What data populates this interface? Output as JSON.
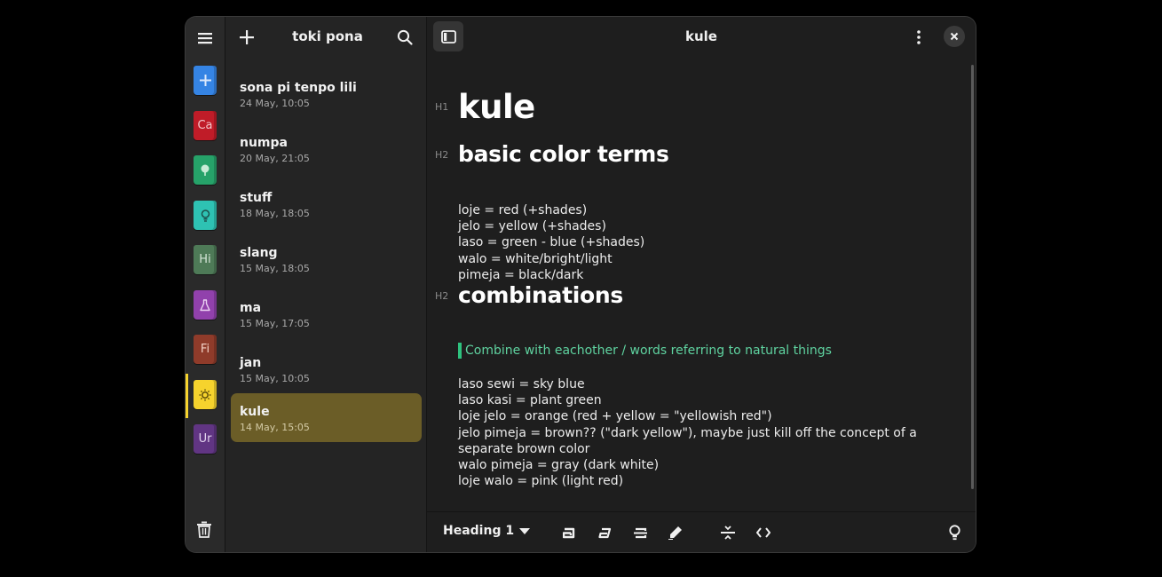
{
  "window": {
    "background": "#1e1e1e",
    "accent": "#f6d32d",
    "selection_color": "#6b5d27"
  },
  "rail": {
    "menu_icon": "hamburger-menu-icon",
    "notebooks": [
      {
        "label": "",
        "icon": "plus-icon",
        "color": "#3584e4"
      },
      {
        "label": "Ca",
        "icon": "",
        "color": "#c01c28"
      },
      {
        "label": "",
        "icon": "tree-icon",
        "color": "#26a269"
      },
      {
        "label": "",
        "icon": "lightbulb-icon",
        "color": "#2ec2b3"
      },
      {
        "label": "Hi",
        "icon": "",
        "color": "#4e7a57"
      },
      {
        "label": "",
        "icon": "flask-icon",
        "color": "#9141ac"
      },
      {
        "label": "Fi",
        "icon": "",
        "color": "#8f3b2a"
      },
      {
        "label": "",
        "icon": "sun-icon",
        "color": "#f6d32d"
      },
      {
        "label": "Ur",
        "icon": "",
        "color": "#613583"
      }
    ],
    "trash_icon": "trash-icon"
  },
  "list": {
    "title": "toki pona",
    "notes": [
      {
        "title": "sona pi tenpo lili",
        "date": "24 May, 10:05"
      },
      {
        "title": "numpa",
        "date": "20 May, 21:05"
      },
      {
        "title": "stuff",
        "date": "18 May, 18:05"
      },
      {
        "title": "slang",
        "date": "15 May, 18:05"
      },
      {
        "title": "ma",
        "date": "15 May, 17:05"
      },
      {
        "title": "jan",
        "date": "15 May, 10:05"
      },
      {
        "title": "kule",
        "date": "14 May, 15:05"
      }
    ]
  },
  "editor": {
    "title": "kule",
    "h1_marker": "H1",
    "h2_marker": "H2",
    "heading1": "kule",
    "heading2a": "basic color terms",
    "basic_terms": [
      "loje = red (+shades)",
      "jelo = yellow (+shades)",
      "laso = green - blue (+shades)",
      "walo = white/bright/light",
      "pimeja = black/dark"
    ],
    "heading2b": "combinations",
    "quote": "Combine with eachother / words referring to natural things",
    "combinations": [
      "laso sewi = sky blue",
      "laso kasi = plant green",
      "loje jelo = orange (red + yellow = \"yellowish red\")",
      "jelo pimeja = brown?? (\"dark yellow\"), maybe just kill off the concept of a separate brown color",
      "walo pimeja = gray (dark white)",
      "loje walo = pink (light red)"
    ]
  },
  "toolbar": {
    "style_label": "Heading 1"
  }
}
